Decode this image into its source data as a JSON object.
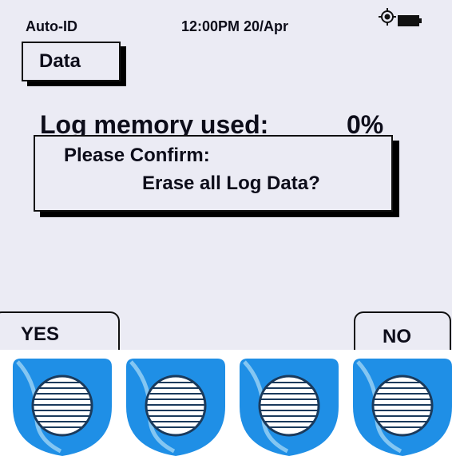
{
  "status_bar": {
    "mode": "Auto-ID",
    "clock": "12:00PM 20/Apr",
    "icons": [
      "gps-location-icon",
      "battery-full-icon"
    ]
  },
  "screen": {
    "title": "Data",
    "memory_label": "Log memory used:",
    "memory_value": "0%"
  },
  "dialog": {
    "line1": "Please Confirm:",
    "line2": "Erase all Log Data?"
  },
  "softkeys": {
    "left": "YES",
    "right": "NO"
  },
  "hardware_keys": [
    {
      "name": "function-key-1",
      "icon": "striped-circle-icon"
    },
    {
      "name": "function-key-2",
      "icon": "striped-circle-icon"
    },
    {
      "name": "function-key-3",
      "icon": "striped-circle-icon"
    },
    {
      "name": "function-key-4",
      "icon": "striped-circle-icon"
    }
  ],
  "colors": {
    "screen_bg": "#ebebf4",
    "key_blue": "#1f8fe6",
    "key_light": "#9ed3f5",
    "text": "#0d0d1a"
  }
}
